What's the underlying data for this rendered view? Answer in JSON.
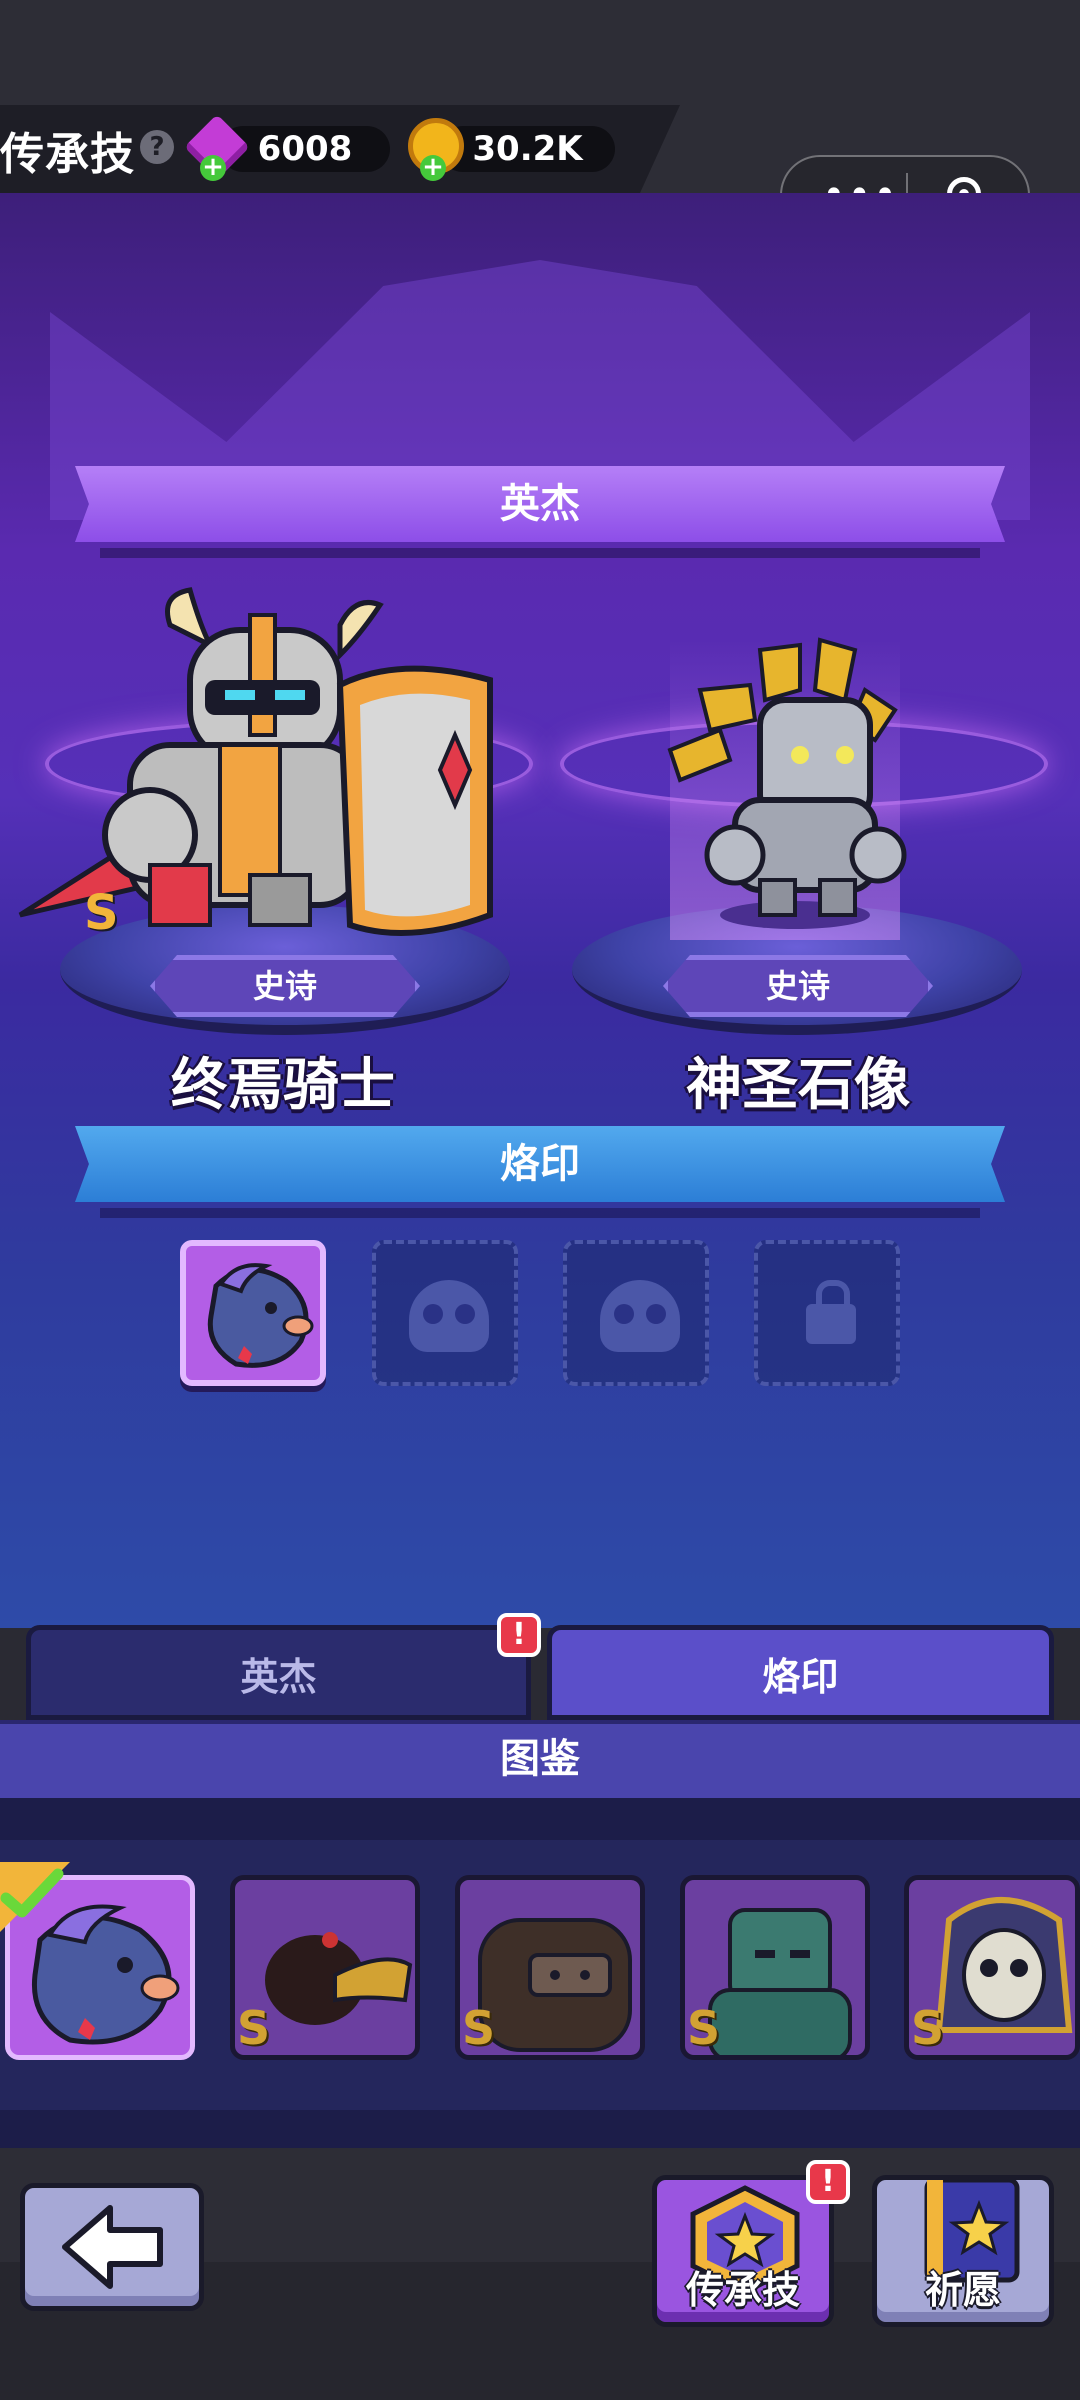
{
  "header": {
    "title": "传承技",
    "help_icon": "?",
    "gems": "6008",
    "coins": "30.2K",
    "capsule_dots": "•••"
  },
  "hero_section": {
    "banner": "英杰",
    "heroes": [
      {
        "name": "终焉骑士",
        "rarity": "史诗",
        "grade": "S"
      },
      {
        "name": "神圣石像",
        "rarity": "史诗"
      }
    ]
  },
  "seal_section": {
    "banner": "烙印",
    "slots": [
      "filled",
      "empty",
      "empty",
      "locked"
    ]
  },
  "tabs": [
    {
      "label": "英杰",
      "alert": "!"
    },
    {
      "label": "烙印"
    }
  ],
  "collection": {
    "title": "图鉴",
    "cards": [
      {
        "grade": "",
        "selected": true
      },
      {
        "grade": "S"
      },
      {
        "grade": "S"
      },
      {
        "grade": "S"
      },
      {
        "grade": "S"
      }
    ]
  },
  "bottom_bar": {
    "skill_button": "传承技",
    "skill_alert": "!",
    "wish_button": "祈愿"
  },
  "colors": {
    "hero_banner": "#9b5cf0",
    "seal_banner": "#3a8fe0",
    "alert": "#e8384a",
    "grade_gold": "#d2a233"
  }
}
